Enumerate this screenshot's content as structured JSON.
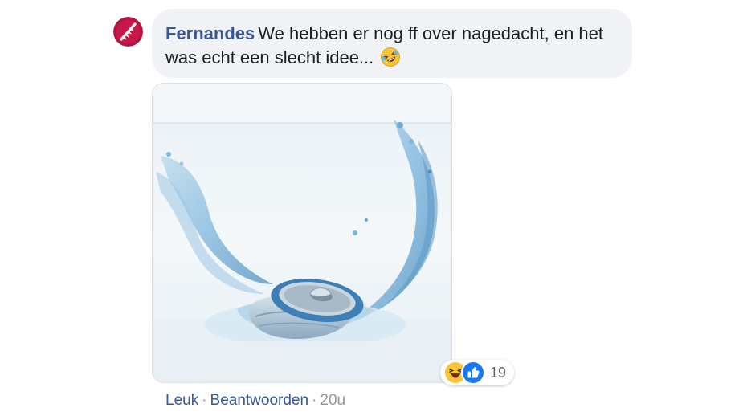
{
  "comment": {
    "author": "Fernandes",
    "text": "We hebben er nog ff over nagedacht, en het was echt een slecht idee...",
    "inline_emoji": "rolling-on-floor-laughing-emoji",
    "avatar_color": "#b5123f"
  },
  "attachment": {
    "image": "water-splash-crushed-can-icon"
  },
  "reactions": {
    "icons": [
      "haha-reaction-icon",
      "like-reaction-icon"
    ],
    "count": "19"
  },
  "actions": {
    "like_label": "Leuk",
    "separator": "·",
    "reply_label": "Beantwoorden",
    "timestamp": "20u"
  },
  "colors": {
    "link": "#385898",
    "bubble_bg": "#f0f2f5",
    "muted": "#90949c",
    "like_blue": "#1877f2",
    "haha_yellow": "#f7c638"
  }
}
